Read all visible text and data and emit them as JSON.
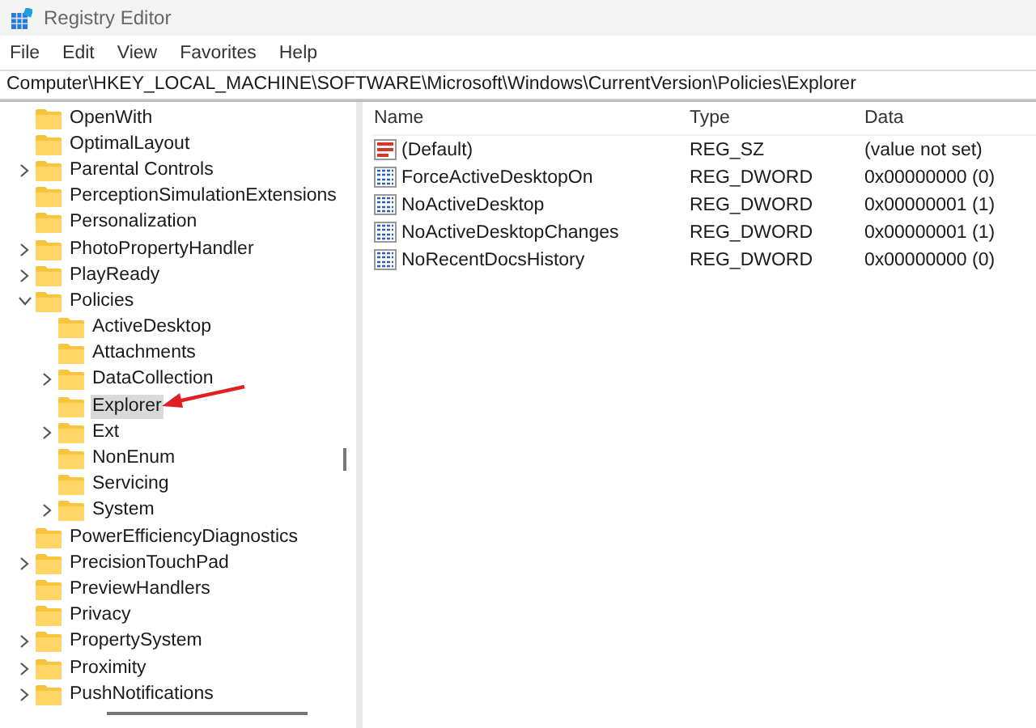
{
  "window": {
    "title": "Registry Editor"
  },
  "menu": [
    "File",
    "Edit",
    "View",
    "Favorites",
    "Help"
  ],
  "address": "Computer\\HKEY_LOCAL_MACHINE\\SOFTWARE\\Microsoft\\Windows\\CurrentVersion\\Policies\\Explorer",
  "tree": [
    {
      "label": "OpenWith",
      "selected": false
    },
    {
      "label": "OptimalLayout",
      "selected": false
    },
    {
      "label": "Parental Controls",
      "expanded": false,
      "selected": false
    },
    {
      "label": "PerceptionSimulationExtensions",
      "selected": false
    },
    {
      "label": "Personalization",
      "selected": false
    },
    {
      "label": "PhotoPropertyHandler",
      "expanded": false,
      "selected": false
    },
    {
      "label": "PlayReady",
      "expanded": false,
      "selected": false
    },
    {
      "label": "Policies",
      "expanded": true,
      "selected": false,
      "children": [
        {
          "label": "ActiveDesktop",
          "selected": false
        },
        {
          "label": "Attachments",
          "selected": false
        },
        {
          "label": "DataCollection",
          "expanded": false,
          "selected": false
        },
        {
          "label": "Explorer",
          "selected": true
        },
        {
          "label": "Ext",
          "expanded": false,
          "selected": false
        },
        {
          "label": "NonEnum",
          "selected": false
        },
        {
          "label": "Servicing",
          "selected": false
        },
        {
          "label": "System",
          "expanded": false,
          "selected": false
        }
      ]
    },
    {
      "label": "PowerEfficiencyDiagnostics",
      "selected": false
    },
    {
      "label": "PrecisionTouchPad",
      "expanded": false,
      "selected": false
    },
    {
      "label": "PreviewHandlers",
      "selected": false
    },
    {
      "label": "Privacy",
      "selected": false
    },
    {
      "label": "PropertySystem",
      "expanded": false,
      "selected": false
    },
    {
      "label": "Proximity",
      "expanded": false,
      "selected": false
    },
    {
      "label": "PushNotifications",
      "expanded": false,
      "selected": false
    }
  ],
  "values": {
    "columns": [
      "Name",
      "Type",
      "Data"
    ],
    "rows": [
      {
        "kind": "string",
        "name": "(Default)",
        "type": "REG_SZ",
        "data": "(value not set)"
      },
      {
        "kind": "dword",
        "name": "ForceActiveDesktopOn",
        "type": "REG_DWORD",
        "data": "0x00000000 (0)"
      },
      {
        "kind": "dword",
        "name": "NoActiveDesktop",
        "type": "REG_DWORD",
        "data": "0x00000001 (1)"
      },
      {
        "kind": "dword",
        "name": "NoActiveDesktopChanges",
        "type": "REG_DWORD",
        "data": "0x00000001 (1)"
      },
      {
        "kind": "dword",
        "name": "NoRecentDocsHistory",
        "type": "REG_DWORD",
        "data": "0x00000000 (0)"
      }
    ]
  }
}
